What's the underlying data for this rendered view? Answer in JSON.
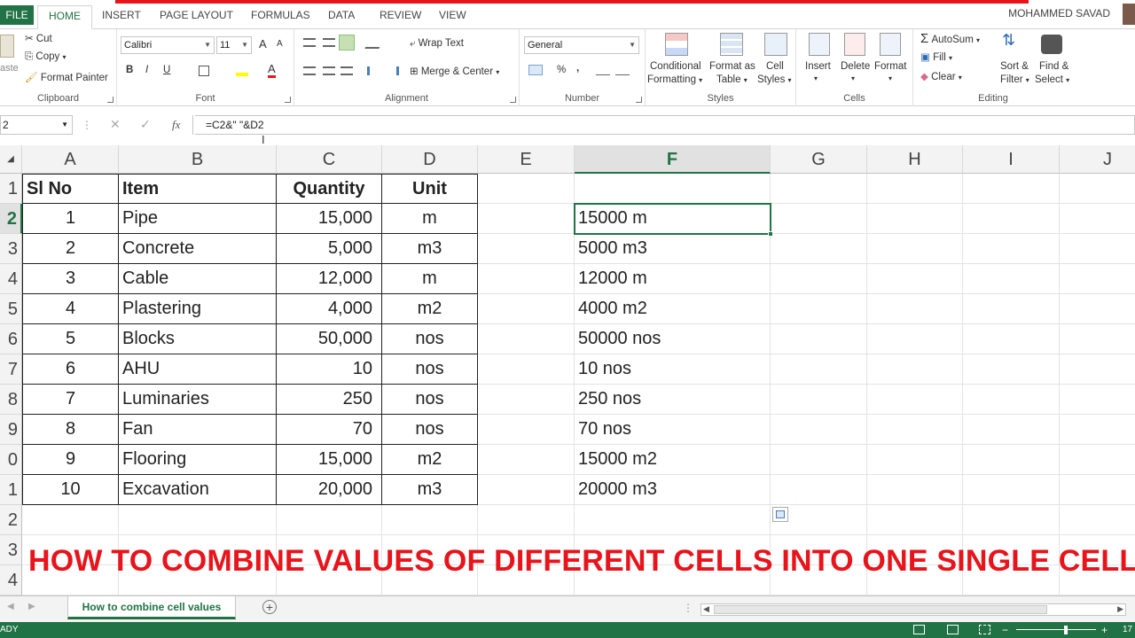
{
  "tabs": {
    "file": "FILE",
    "items": [
      "HOME",
      "INSERT",
      "PAGE LAYOUT",
      "FORMULAS",
      "DATA",
      "REVIEW",
      "VIEW"
    ],
    "user": "MOHAMMED SAVAD"
  },
  "ribbon": {
    "clipboard": {
      "paste": "aste",
      "cut": "Cut",
      "copy": "Copy",
      "painter": "Format Painter",
      "name": "Clipboard"
    },
    "font": {
      "family": "Calibri",
      "size": "11",
      "bold": "B",
      "italic": "I",
      "underline": "U",
      "grow": "A",
      "shrink": "A",
      "color": "A",
      "name": "Font"
    },
    "alignment": {
      "wrap": "Wrap Text",
      "merge": "Merge & Center",
      "name": "Alignment"
    },
    "number": {
      "format": "General",
      "percent": "%",
      "comma": ",",
      "name": "Number"
    },
    "styles": {
      "cond1": "Conditional",
      "cond2": "Formatting",
      "table1": "Format as",
      "table2": "Table",
      "cell1": "Cell",
      "cell2": "Styles",
      "name": "Styles"
    },
    "cells": {
      "insert": "Insert",
      "delete": "Delete",
      "format": "Format",
      "name": "Cells"
    },
    "editing": {
      "autosum": "AutoSum",
      "fill": "Fill",
      "clear": "Clear",
      "sort1": "Sort &",
      "sort2": "Filter",
      "find1": "Find &",
      "find2": "Select",
      "name": "Editing"
    }
  },
  "formula_bar": {
    "name_box": "2",
    "fx": "fx",
    "formula": "=C2&\" \"&D2"
  },
  "columns": [
    "A",
    "B",
    "C",
    "D",
    "E",
    "F",
    "G",
    "H",
    "I",
    "J"
  ],
  "rows": [
    "1",
    "2",
    "3",
    "4",
    "5",
    "6",
    "7",
    "8",
    "9",
    "0",
    "1",
    "2",
    "3",
    "4"
  ],
  "table": {
    "headers": [
      "Sl No",
      "Item",
      "Quantity",
      "Unit"
    ],
    "data": [
      [
        "1",
        "Pipe",
        "15,000",
        "m",
        "15000 m"
      ],
      [
        "2",
        "Concrete",
        "5,000",
        "m3",
        "5000 m3"
      ],
      [
        "3",
        "Cable",
        "12,000",
        "m",
        "12000 m"
      ],
      [
        "4",
        "Plastering",
        "4,000",
        "m2",
        "4000 m2"
      ],
      [
        "5",
        "Blocks",
        "50,000",
        "nos",
        "50000 nos"
      ],
      [
        "6",
        "AHU",
        "10",
        "nos",
        "10 nos"
      ],
      [
        "7",
        "Luminaries",
        "250",
        "nos",
        "250 nos"
      ],
      [
        "8",
        "Fan",
        "70",
        "nos",
        "70 nos"
      ],
      [
        "9",
        "Flooring",
        "15,000",
        "m2",
        "15000 m2"
      ],
      [
        "10",
        "Excavation",
        "20,000",
        "m3",
        "20000 m3"
      ]
    ]
  },
  "overlay_title": "HOW TO COMBINE VALUES OF DIFFERENT CELLS INTO ONE SINGLE CELL",
  "sheet": {
    "tab": "How to combine cell values",
    "add": "+"
  },
  "status": {
    "ready": "ADY",
    "zoom": "17"
  },
  "colors": {
    "excel_green": "#217346",
    "title_red": "#e8141b"
  }
}
